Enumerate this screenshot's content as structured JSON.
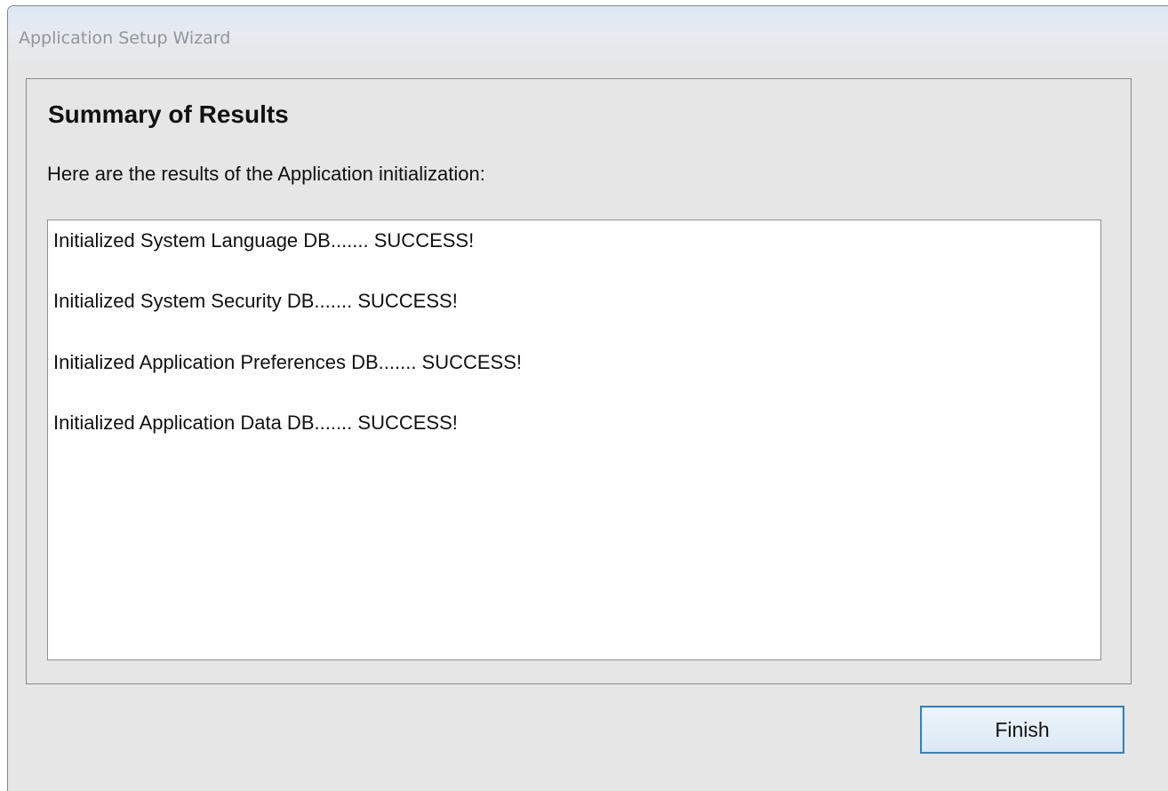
{
  "window": {
    "title": "Application Setup Wizard"
  },
  "summary": {
    "heading": "Summary of Results",
    "description": "Here are the results of the Application initialization:",
    "results": [
      "Initialized System Language DB....... SUCCESS!",
      "Initialized System Security DB....... SUCCESS!",
      "Initialized Application Preferences DB....... SUCCESS!",
      "Initialized Application Data DB....... SUCCESS!"
    ]
  },
  "buttons": {
    "finish_label": "Finish"
  },
  "colors": {
    "button_border": "#3c7fb1",
    "window_background": "#e6e6e6",
    "results_background": "#ffffff"
  }
}
